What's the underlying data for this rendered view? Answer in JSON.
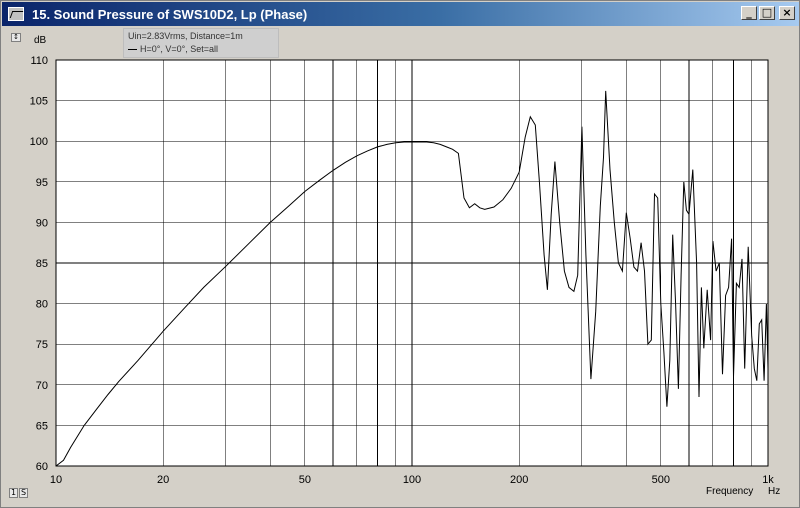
{
  "window": {
    "title": "15. Sound Pressure of SWS10D2, Lp (Phase)",
    "buttons": {
      "minimize": "_",
      "maximize": "□",
      "close": "×"
    }
  },
  "legend": {
    "line1": "Uin=2.83Vrms, Distance=1m",
    "line2": "H=0°, V=0°, Set=all"
  },
  "chart_data": {
    "type": "line",
    "title": "Sound Pressure of SWS10D2, Lp (Phase)",
    "xlabel": "Frequency",
    "xunit": "Hz",
    "ylabel": "dB",
    "xscale": "log",
    "xlim": [
      10,
      1000
    ],
    "ylim": [
      60,
      110
    ],
    "grid": true,
    "y_ticks": [
      60,
      65,
      70,
      75,
      80,
      85,
      90,
      95,
      100,
      105,
      110
    ],
    "y_tick_labels": [
      "60",
      "65",
      "70",
      "75",
      "80",
      "85",
      "90",
      "95",
      "100",
      "105",
      "110"
    ],
    "x_ticks": [
      10,
      20,
      50,
      100,
      200,
      500,
      1000
    ],
    "x_tick_labels": [
      "10",
      "20",
      "50",
      "100",
      "200",
      "500",
      "1k"
    ],
    "series": [
      {
        "name": "H=0°, V=0°, Set=all",
        "x": [
          10,
          10.5,
          11,
          12,
          13,
          14,
          15,
          17,
          20,
          23,
          26,
          30,
          35,
          40,
          45,
          50,
          55,
          60,
          65,
          70,
          75,
          80,
          85,
          90,
          95,
          100,
          105,
          110,
          115,
          120,
          125,
          130,
          135,
          140,
          145,
          150,
          155,
          160,
          170,
          180,
          190,
          200,
          208,
          215,
          222,
          228,
          235,
          240,
          246,
          252,
          260,
          268,
          276,
          285,
          292,
          300,
          308,
          318,
          328,
          338,
          345,
          350,
          360,
          370,
          380,
          390,
          400,
          410,
          420,
          430,
          440,
          450,
          460,
          470,
          480,
          490,
          500,
          510,
          520,
          530,
          540,
          550,
          560,
          570,
          580,
          590,
          600,
          615,
          630,
          640,
          650,
          660,
          675,
          690,
          700,
          715,
          730,
          745,
          760,
          775,
          790,
          800,
          815,
          830,
          845,
          860,
          880,
          900,
          915,
          930,
          945,
          960,
          975,
          990,
          1000
        ],
        "values": [
          60,
          60.7,
          62.3,
          65,
          67,
          68.8,
          70.4,
          73,
          76.6,
          79.5,
          82,
          84.6,
          87.5,
          90,
          92,
          93.8,
          95.2,
          96.4,
          97.4,
          98.2,
          98.8,
          99.3,
          99.6,
          99.8,
          99.9,
          99.9,
          99.9,
          99.9,
          99.8,
          99.6,
          99.3,
          99,
          98.5,
          93,
          91.8,
          92.3,
          91.8,
          91.6,
          91.9,
          92.8,
          94.2,
          96.2,
          100.5,
          103,
          102,
          95,
          86,
          81.7,
          91,
          97.5,
          90,
          84,
          82,
          81.5,
          83.5,
          101.8,
          86,
          70.7,
          79,
          92,
          98,
          106.2,
          96.5,
          90,
          85,
          84,
          91.2,
          88,
          84.5,
          84,
          87.5,
          84,
          75,
          75.5,
          93.5,
          93,
          80,
          74,
          67.3,
          73,
          88.5,
          80,
          69.5,
          83.5,
          95,
          91.5,
          91,
          96.5,
          85,
          68.5,
          82,
          74.5,
          81.7,
          75.5,
          87.7,
          84,
          85,
          71.3,
          81,
          82,
          88,
          71,
          82.5,
          82,
          85.5,
          72,
          87,
          76,
          72,
          70.5,
          77.5,
          78,
          70.5,
          80,
          72
        ]
      }
    ]
  },
  "axis": {
    "y_unit": "dB",
    "x_label": "Frequency",
    "x_unit": "Hz"
  },
  "colors": {
    "titlebar_start": "#0a246a",
    "titlebar_end": "#a6caf0",
    "plot_bg": "#ffffff",
    "grid": "#000000",
    "curve": "#000000",
    "window_bg": "#d4d0c8"
  },
  "icons": {
    "app": "chart-app-icon",
    "bottom_left_1": "scale-icon",
    "bottom_left_2": "settings-icon",
    "top_left": "pin-icon"
  }
}
